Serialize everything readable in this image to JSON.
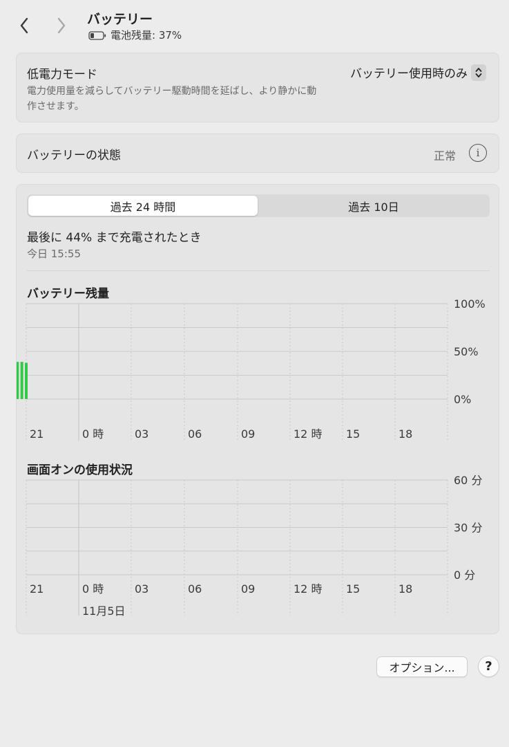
{
  "header": {
    "title": "バッテリー",
    "subtitle": "電池残量: 37%",
    "battery_icon": "battery-low-icon",
    "back_icon": "chevron-left-icon",
    "forward_icon": "chevron-right-icon"
  },
  "low_power": {
    "title": "低電力モード",
    "description": "電力使用量を減らしてバッテリー駆動時間を延ばし、より静かに動作させます。",
    "selected": "バッテリー使用時のみ"
  },
  "health": {
    "label": "バッテリーの状態",
    "value": "正常"
  },
  "usage": {
    "tabs": [
      "過去 24 時間",
      "過去 10日"
    ],
    "active_tab": 0,
    "last_charged": "最後に 44% まで充電されたとき",
    "last_charged_time": "今日 15:55"
  },
  "colors": {
    "bar_green": "#34c84a",
    "grid": "#c9c9c9"
  },
  "chart_data": [
    {
      "type": "bar",
      "title": "バッテリー残量",
      "x_tick_labels": [
        "21",
        "0 時",
        "03",
        "06",
        "09",
        "12 時",
        "15",
        "18"
      ],
      "y_tick_labels": [
        "100%",
        "50%",
        "0%"
      ],
      "ylim": [
        0,
        100
      ],
      "x_start_hour": 20,
      "bars_start_hour": 15.75,
      "bar_step_hours": 0.25,
      "values": [
        42,
        42,
        42,
        42,
        42,
        42,
        41,
        41,
        41,
        41,
        41,
        40,
        40,
        40,
        40,
        39,
        39,
        38
      ],
      "grid": true
    },
    {
      "type": "bar",
      "title": "画面オンの使用状況",
      "x_tick_labels": [
        "21",
        "0 時",
        "03",
        "06",
        "09",
        "12 時",
        "15",
        "18"
      ],
      "y_tick_labels": [
        "60 分",
        "30 分",
        "0 分"
      ],
      "ylim": [
        0,
        60
      ],
      "date_label": "11月5日",
      "values": [],
      "grid": true
    }
  ],
  "footer": {
    "options_label": "オプション...",
    "help_label": "?"
  }
}
